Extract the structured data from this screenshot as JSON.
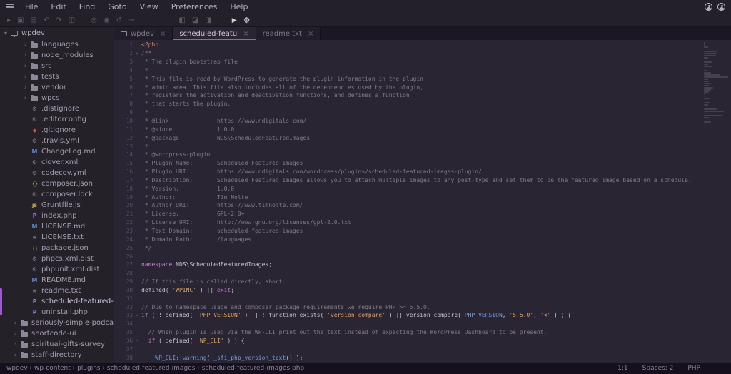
{
  "colors": {
    "accent": "#9d5bd2",
    "tag": "#e2814e",
    "comment": "#7e7a86",
    "keyword": "#c379cf",
    "string": "#dda05d",
    "function": "#6d9edb",
    "text": "#c9c2d1"
  },
  "menubar": {
    "items": [
      "File",
      "Edit",
      "Find",
      "Goto",
      "View",
      "Preferences",
      "Help"
    ]
  },
  "toolbar": {
    "groups": [
      {
        "icons": [
          "open-folder",
          "save",
          "save-all",
          "undo",
          "redo",
          "preview"
        ]
      },
      {
        "icons": [
          "find",
          "find-in-files",
          "replace",
          "go-to"
        ]
      },
      {
        "icons": [
          "toggle-left-pane",
          "toggle-bottom-pane",
          "toggle-right-pane"
        ]
      },
      {
        "icons": [
          "run",
          "settings"
        ],
        "bright": true
      }
    ]
  },
  "sidebar": {
    "header": {
      "label": "wpdev"
    },
    "items": [
      {
        "label": "languages",
        "icon": "folder",
        "level": 2,
        "chevron": true
      },
      {
        "label": "node_modules",
        "icon": "folder",
        "level": 2,
        "chevron": true
      },
      {
        "label": "src",
        "icon": "folder",
        "level": 2,
        "chevron": true
      },
      {
        "label": "tests",
        "icon": "folder",
        "level": 2,
        "chevron": true
      },
      {
        "label": "vendor",
        "icon": "folder",
        "level": 2,
        "chevron": true
      },
      {
        "label": "wpcs",
        "icon": "folder",
        "level": 2,
        "chevron": true
      },
      {
        "label": ".distignore",
        "icon": "gear",
        "level": 2
      },
      {
        "label": ".editorconfig",
        "icon": "gear",
        "level": 2
      },
      {
        "label": ".gitignore",
        "icon": "git",
        "level": 2
      },
      {
        "label": ".travis.yml",
        "icon": "gear",
        "level": 2
      },
      {
        "label": "ChangeLog.md",
        "icon": "markdown",
        "level": 2
      },
      {
        "label": "clover.xml",
        "icon": "gear",
        "level": 2
      },
      {
        "label": "codecov.yml",
        "icon": "gear",
        "level": 2
      },
      {
        "label": "composer.json",
        "icon": "json",
        "level": 2
      },
      {
        "label": "composer.lock",
        "icon": "gear",
        "level": 2
      },
      {
        "label": "Gruntfile.js",
        "icon": "js",
        "level": 2
      },
      {
        "label": "index.php",
        "icon": "php",
        "level": 2
      },
      {
        "label": "LICENSE.md",
        "icon": "markdown",
        "level": 2
      },
      {
        "label": "LICENSE.txt",
        "icon": "text",
        "level": 2
      },
      {
        "label": "package.json",
        "icon": "json",
        "level": 2
      },
      {
        "label": "phpcs.xml.dist",
        "icon": "gear",
        "level": 2
      },
      {
        "label": "phpunit.xml.dist",
        "icon": "gear",
        "level": 2
      },
      {
        "label": "README.md",
        "icon": "markdown",
        "level": 2
      },
      {
        "label": "readme.txt",
        "icon": "text",
        "level": 2
      },
      {
        "label": "scheduled-featured-images.php",
        "icon": "php",
        "level": 2,
        "selected": true
      },
      {
        "label": "uninstall.php",
        "icon": "php",
        "level": 2
      },
      {
        "label": "seriously-simple-podcast",
        "icon": "folder",
        "level": 1,
        "chevron": true
      },
      {
        "label": "shortcode-ui",
        "icon": "folder",
        "level": 1,
        "chevron": true
      },
      {
        "label": "spiritual-gifts-survey",
        "icon": "folder",
        "level": 1,
        "chevron": true
      },
      {
        "label": "staff-directory",
        "icon": "folder",
        "level": 1,
        "chevron": true
      }
    ]
  },
  "tabs": [
    {
      "label": "wpdev",
      "icon": "project-icon",
      "active": false
    },
    {
      "label": "scheduled-featu",
      "active": true
    },
    {
      "label": "readme.txt",
      "active": false
    }
  ],
  "editor": {
    "lines": [
      {
        "t": [
          [
            "tag",
            "<?php"
          ]
        ]
      },
      {
        "fold": true,
        "t": [
          [
            "cm",
            "/**"
          ]
        ]
      },
      {
        "t": [
          [
            "cm",
            " * The plugin bootstrap file"
          ]
        ]
      },
      {
        "t": [
          [
            "cm",
            " *"
          ]
        ]
      },
      {
        "t": [
          [
            "cm",
            " * This file is read by WordPress to generate the plugin information in the plugin"
          ]
        ]
      },
      {
        "t": [
          [
            "cm",
            " * admin area. This file also includes all of the dependencies used by the plugin,"
          ]
        ]
      },
      {
        "t": [
          [
            "cm",
            " * registers the activation and deactivation functions, and defines a function"
          ]
        ]
      },
      {
        "t": [
          [
            "cm",
            " * that starts the plugin."
          ]
        ]
      },
      {
        "t": [
          [
            "cm",
            " *"
          ]
        ]
      },
      {
        "t": [
          [
            "cm",
            " * @link              https://www.ndigitals.com/"
          ]
        ]
      },
      {
        "t": [
          [
            "cm",
            " * @since             1.0.0"
          ]
        ]
      },
      {
        "t": [
          [
            "cm",
            " * @package           NDS\\ScheduledFeaturedImages"
          ]
        ]
      },
      {
        "t": [
          [
            "cm",
            " *"
          ]
        ]
      },
      {
        "t": [
          [
            "cm",
            " * @wordpress-plugin"
          ]
        ]
      },
      {
        "t": [
          [
            "cm",
            " * Plugin Name:       Scheduled Featured Images"
          ]
        ]
      },
      {
        "t": [
          [
            "cm",
            " * Plugin URI:        https://www.ndigitals.com/wordpress/plugins/scheduled-featured-images-plugin/"
          ]
        ]
      },
      {
        "t": [
          [
            "cm",
            " * Description:       Scheduled Featured Images allows you to attach multiple images to any post-type and set them to be the featured image based on a schedule."
          ]
        ]
      },
      {
        "t": [
          [
            "cm",
            " * Version:           1.0.0"
          ]
        ]
      },
      {
        "t": [
          [
            "cm",
            " * Author:            Tim Nolte"
          ]
        ]
      },
      {
        "t": [
          [
            "cm",
            " * Author URI:        https://www.timnolte.com/"
          ]
        ]
      },
      {
        "t": [
          [
            "cm",
            " * License:           GPL-2.0+"
          ]
        ]
      },
      {
        "t": [
          [
            "cm",
            " * License URI:       http://www.gnu.org/licenses/gpl-2.0.txt"
          ]
        ]
      },
      {
        "t": [
          [
            "cm",
            " * Text Domain:       scheduled-featured-images"
          ]
        ]
      },
      {
        "t": [
          [
            "cm",
            " * Domain Path:       /languages"
          ]
        ]
      },
      {
        "t": [
          [
            "cm",
            " */"
          ]
        ]
      },
      {
        "t": []
      },
      {
        "t": [
          [
            "kw",
            "namespace"
          ],
          [
            "id",
            " NDS\\ScheduledFeaturedImages;"
          ]
        ]
      },
      {
        "t": []
      },
      {
        "t": [
          [
            "cm",
            "// If this file is called directly, abort."
          ]
        ]
      },
      {
        "t": [
          [
            "id",
            "defined( "
          ],
          [
            "str",
            "'WPINC'"
          ],
          [
            "id",
            " ) || "
          ],
          [
            "kw",
            "exit"
          ],
          [
            "id",
            ";"
          ]
        ]
      },
      {
        "t": []
      },
      {
        "t": [
          [
            "cm",
            "// Due to namespace usage and composer package requirements we require PHP >= 5.5.0."
          ]
        ]
      },
      {
        "fold": true,
        "t": [
          [
            "kw",
            "if"
          ],
          [
            "id",
            " ( ! defined( "
          ],
          [
            "str",
            "'PHP_VERSION'"
          ],
          [
            "id",
            " ) || ! function_exists( "
          ],
          [
            "str",
            "'version_compare'"
          ],
          [
            "id",
            " ) || version_compare( "
          ],
          [
            "const",
            "PHP_VERSION"
          ],
          [
            "id",
            ", "
          ],
          [
            "str",
            "'5.5.0'"
          ],
          [
            "id",
            ", "
          ],
          [
            "str",
            "'<'"
          ],
          [
            "id",
            " ) ) {"
          ]
        ]
      },
      {
        "t": []
      },
      {
        "t": [
          [
            "cm",
            "  // When plugin is used via the WP-CLI print out the text instead of expecting the WordPress Dashboard to be present."
          ]
        ]
      },
      {
        "fold": true,
        "t": [
          [
            "id",
            "  "
          ],
          [
            "kw",
            "if"
          ],
          [
            "id",
            " ( defined( "
          ],
          [
            "str",
            "'WP_CLI'"
          ],
          [
            "id",
            " ) ) {"
          ]
        ]
      },
      {
        "t": []
      },
      {
        "t": [
          [
            "id",
            "    "
          ],
          [
            "fn",
            "WP_CLI::warning"
          ],
          [
            "id",
            "( "
          ],
          [
            "fn",
            "_sfi_php_version_text"
          ],
          [
            "id",
            "() );"
          ]
        ]
      }
    ]
  },
  "statusbar": {
    "path": "wpdev › wp-content › plugins › scheduled-featured-images › scheduled-featured-images.php",
    "cursor": "1:1",
    "indent": "Spaces: 2",
    "language": "PHP"
  }
}
